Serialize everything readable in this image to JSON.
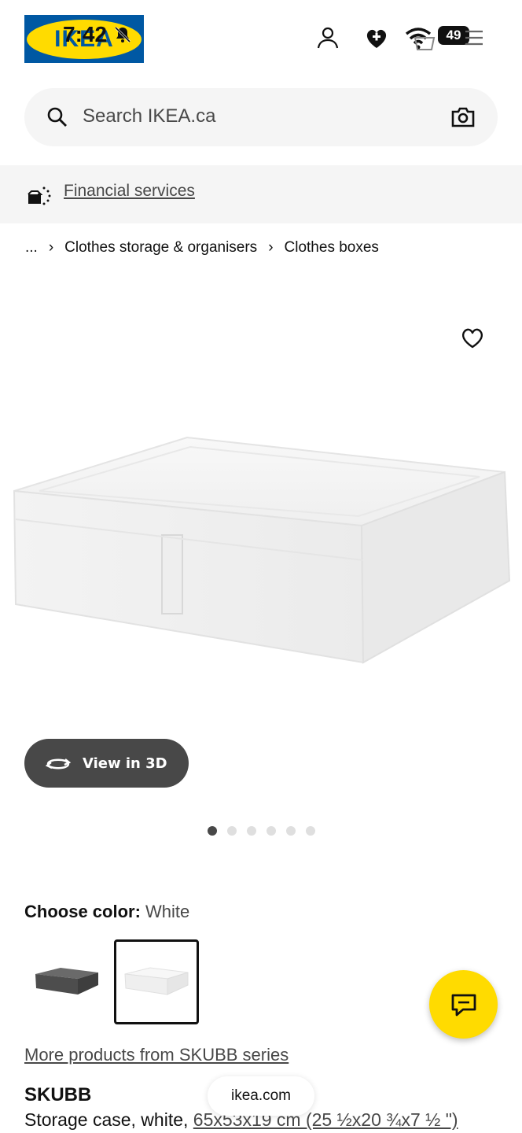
{
  "status_bar": {
    "time": "7:42",
    "battery": "49"
  },
  "header": {
    "logo_text": "IKEA"
  },
  "search": {
    "placeholder": "Search IKEA.ca"
  },
  "finance": {
    "label": "Financial services"
  },
  "breadcrumb": {
    "items": [
      "...",
      "Clothes storage & organisers",
      "Clothes boxes"
    ]
  },
  "gallery": {
    "view3d_label": "View in 3D",
    "dot_count": 6,
    "active_dot": 1
  },
  "color_picker": {
    "label": "Choose color:",
    "value": "White",
    "swatches": [
      "dark grey",
      "white"
    ],
    "selected_swatch": "white"
  },
  "product": {
    "series_link": "More products from SKUBB series",
    "name": "SKUBB",
    "description_prefix": "Storage case, white, ",
    "dimensions": "65x53x19 cm (25 ½x20 ¾x7 ½ \")"
  },
  "browser": {
    "url": "ikea.com"
  },
  "colors": {
    "ikea_blue": "#0058a3",
    "ikea_yellow": "#ffdb00",
    "dark_grey": "#484848"
  }
}
